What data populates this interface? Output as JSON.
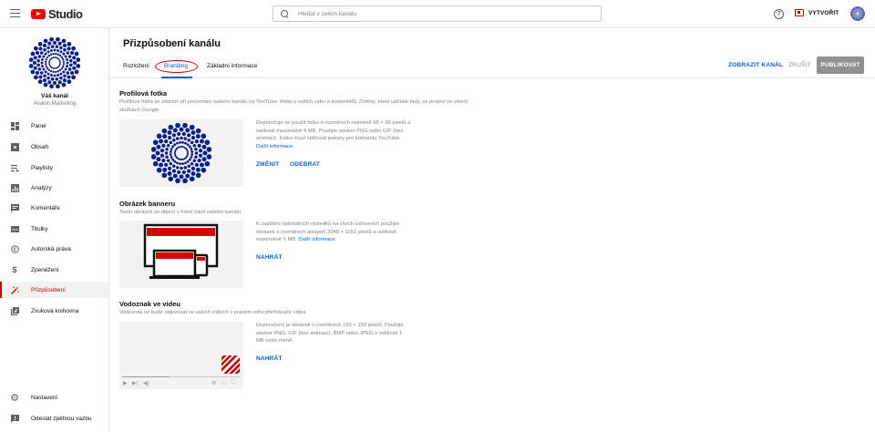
{
  "header": {
    "logo_text": "Studio",
    "search_placeholder": "Hledat v celém kanálu",
    "create_label": "VYTVOŘIT"
  },
  "sidebar": {
    "channel_name": "Váš kanál",
    "channel_subtitle": "Avalon Marketing",
    "items": [
      {
        "label": "Panel",
        "icon": "dashboard-icon"
      },
      {
        "label": "Obsah",
        "icon": "content-icon"
      },
      {
        "label": "Playlisty",
        "icon": "playlist-icon"
      },
      {
        "label": "Analýzy",
        "icon": "analytics-icon"
      },
      {
        "label": "Komentáře",
        "icon": "comments-icon"
      },
      {
        "label": "Titulky",
        "icon": "subtitles-icon"
      },
      {
        "label": "Autorská práva",
        "icon": "copyright-icon"
      },
      {
        "label": "Zpeněžení",
        "icon": "dollar-icon"
      },
      {
        "label": "Přizpůsobení",
        "icon": "magic-wand-icon",
        "active": true
      },
      {
        "label": "Zvuková knihovna",
        "icon": "audio-library-icon"
      }
    ],
    "bottom_items": [
      {
        "label": "Nastavení",
        "icon": "gear-icon"
      },
      {
        "label": "Odeslat zpětnou vazbu",
        "icon": "feedback-icon"
      }
    ]
  },
  "main": {
    "title": "Přizpůsobení kanálu",
    "tabs": [
      {
        "label": "Rozložení"
      },
      {
        "label": "Branding",
        "active": true
      },
      {
        "label": "Základní informace"
      }
    ],
    "actions": {
      "view": "ZOBRAZIT KANÁL",
      "cancel": "ZRUŠIT",
      "publish": "PUBLIKOVAT"
    },
    "sections": {
      "photo": {
        "title": "Profilová fotka",
        "desc": "Profilová fotka se zobrazí při prezentaci vašeho kanálu na YouTube, třeba u vašich videí a komentářů. Změny, které uděláte tady, se projeví ve všech službách Google.",
        "info": "Doporučuje se použít fotku o rozměrech nejméně 98 × 98 pixelů a velikosti maximálně 4 MB. Použijte soubor PNG nebo GIF (bez animací). Fotka musí splňovat pokyny pro komunitu YouTube.",
        "link": "Další informace",
        "change": "ZMĚNIT",
        "remove": "ODEBRAT"
      },
      "banner": {
        "title": "Obrázek banneru",
        "desc": "Tento obrázek se objeví v horní části vašeho kanálu.",
        "info": "K zajištění optimálních výsledků na všech zařízeních použijte obrázek o rozměrech alespoň 2048 × 1152 pixelů a velikosti maximálně 6 MB.",
        "link": "Další informace",
        "upload": "NAHRÁT"
      },
      "watermark": {
        "title": "Vodoznak ve videu",
        "desc": "Vodoznak se bude objevovat ve vašich videích v pravém rohu přehrávače videa",
        "info": "Doporučený je obrázek o rozměrech 150 × 150 pixelů. Použijte soubor PNG, GIF (bez animací), BMP nebo JPEG o velikosti 1 MB nebo méně.",
        "upload": "NAHRÁT"
      }
    }
  },
  "colors": {
    "accent": "#065fd4",
    "active_red": "#cc0000",
    "brand_red": "#ff0000",
    "logo_navy": "#0b1f8f"
  }
}
